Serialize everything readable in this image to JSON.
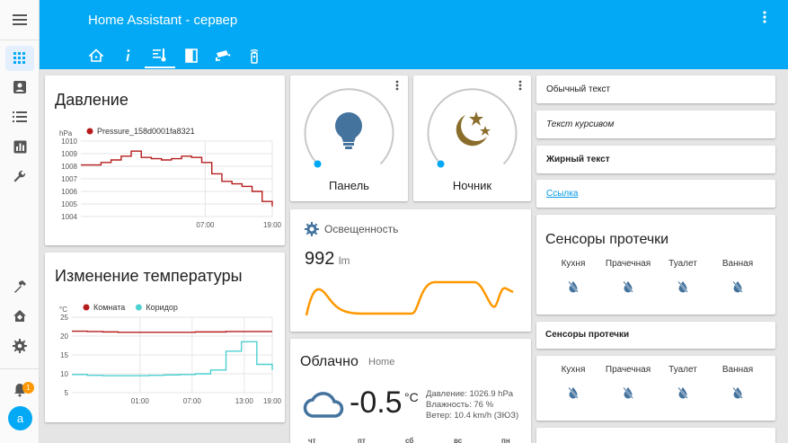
{
  "header": {
    "title": "Home Assistant - сервер"
  },
  "sidebar": {
    "notification_count": "1",
    "user_initial": "a"
  },
  "pressure": {
    "title": "Давление",
    "unit": "hPa",
    "legend": "Pressure_158d0001fa8321",
    "series_color": "#b71c1c",
    "chart_data": {
      "type": "line",
      "title": "Давление",
      "ylabel": "hPa",
      "ylim": [
        1004,
        1010
      ],
      "yticks": [
        "1010",
        "1009",
        "1008",
        "1007",
        "1006",
        "1005",
        "1004"
      ],
      "xticks": [
        "07:00",
        "19:00"
      ],
      "series": [
        {
          "name": "Pressure_158d0001fa8321",
          "color": "#b71c1c",
          "values": [
            1008.1,
            1008.1,
            1008.3,
            1008.5,
            1008.8,
            1009.2,
            1008.7,
            1008.6,
            1008.5,
            1008.6,
            1008.8,
            1008.7,
            1008.3,
            1007.4,
            1006.8,
            1006.6,
            1006.4,
            1006.0,
            1005.2,
            1004.8
          ]
        }
      ]
    }
  },
  "temp": {
    "title": "Изменение температуры",
    "unit": "°C",
    "chart_data": {
      "type": "line",
      "title": "Изменение температуры",
      "ylabel": "°C",
      "ylim": [
        5,
        25
      ],
      "yticks": [
        "25",
        "20",
        "15",
        "10",
        "5"
      ],
      "xticks": [
        "01:00",
        "07:00",
        "13:00",
        "19:00"
      ],
      "series": [
        {
          "name": "Комната",
          "color": "#b71c1c",
          "values": [
            21.3,
            21.2,
            21.1,
            21.0,
            21.0,
            21.0,
            21.0,
            21.0,
            21.1,
            21.1,
            21.2,
            21.2,
            21.2,
            21.2
          ]
        },
        {
          "name": "Коридор",
          "color": "#4dd0d0",
          "values": [
            9.8,
            9.6,
            9.5,
            9.5,
            9.5,
            9.6,
            9.7,
            9.8,
            10.0,
            11.0,
            16.0,
            18.5,
            12.5,
            11.0
          ]
        }
      ]
    }
  },
  "lights": [
    {
      "name": "Панель",
      "color": "#44739e"
    },
    {
      "name": "Ночник",
      "color": "#8a6d2b"
    }
  ],
  "illuminance": {
    "title": "Освещенность",
    "value": "992",
    "unit": "lm"
  },
  "weather": {
    "condition": "Облачно",
    "location": "Home",
    "temperature": "-0.5",
    "unit": "°C",
    "pressure": "Давление: 1026.9 hPa",
    "humidity": "Влажность: 76 %",
    "wind": "Ветер: 10.4 km/h (ЗЮЗ)",
    "days": [
      "чт",
      "пт",
      "сб",
      "вс",
      "пн"
    ]
  },
  "markdown": {
    "normal": "Обычный текст",
    "italic": "Текст курсивом",
    "bold": "Жирный текст",
    "link": "Ссылка"
  },
  "leaks": {
    "title": "Сенсоры протечки",
    "title_small": "Сенсоры протечки",
    "rooms": [
      "Кухня",
      "Прачечная",
      "Туалет",
      "Ванная"
    ]
  }
}
